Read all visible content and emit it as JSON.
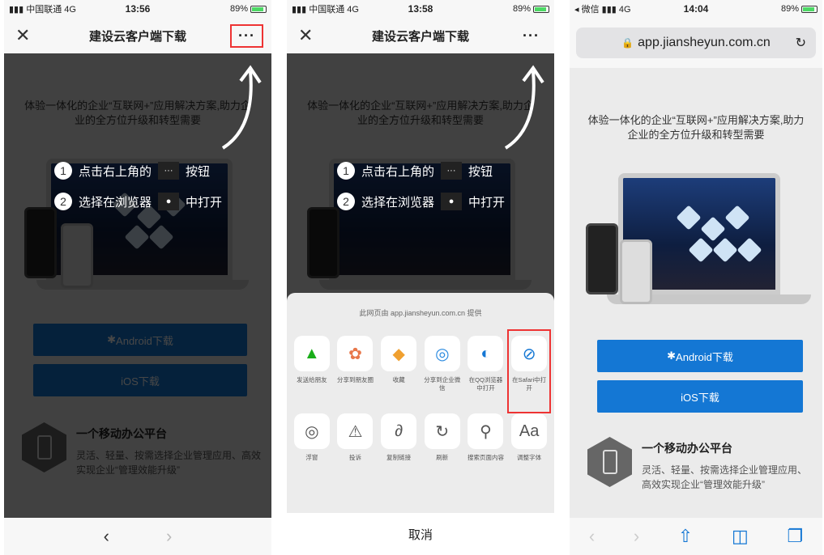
{
  "p1": {
    "status": {
      "carrier": "中国联通",
      "net": "4G",
      "time": "13:56",
      "battery": "89%"
    },
    "nav": {
      "close": "✕",
      "title": "建设云客户端下载",
      "more": "···"
    },
    "guide": {
      "step1_num": "1",
      "step1_text": "点击右上角的",
      "step1_icon": "···",
      "step1_after": "按钮",
      "step2_num": "2",
      "step2_text": "选择在浏览器",
      "step2_icon": "●",
      "step2_after": "中打开"
    },
    "bar": {
      "back": "‹",
      "fwd": "›"
    }
  },
  "p2": {
    "status": {
      "carrier": "中国联通",
      "net": "4G",
      "time": "13:58",
      "battery": "89%"
    },
    "nav": {
      "close": "✕",
      "title": "建设云客户端下载",
      "more": "···"
    },
    "sheet": {
      "source": "此网页由 app.jiansheyun.com.cn 提供",
      "row1": [
        {
          "icon": "▲",
          "label": "发送给朋友"
        },
        {
          "icon": "✿",
          "label": "分享到朋友圈"
        },
        {
          "icon": "◆",
          "label": "收藏"
        },
        {
          "icon": "◎",
          "label": "分享到企业微信"
        },
        {
          "icon": "◐",
          "label": "在QQ浏览器中打开"
        },
        {
          "icon": "⊘",
          "label": "在Safari中打开"
        }
      ],
      "row2": [
        {
          "icon": "◎",
          "label": "浮窗"
        },
        {
          "icon": "⚠",
          "label": "投诉"
        },
        {
          "icon": "∂",
          "label": "复制链接"
        },
        {
          "icon": "↻",
          "label": "刷新"
        },
        {
          "icon": "⚲",
          "label": "搜索页面内容"
        },
        {
          "icon": "Aa",
          "label": "调整字体"
        }
      ],
      "cancel": "取消"
    }
  },
  "p3": {
    "status": {
      "carrier": "微信",
      "net": "4G",
      "time": "14:04",
      "battery": "89%"
    },
    "url": "app.jiansheyun.com.cn",
    "bar": {
      "back": "‹",
      "fwd": "›",
      "share": "⇧",
      "book": "◫",
      "tabs": "❐"
    }
  },
  "content": {
    "tagline": "体验一体化的企业“互联网+”应用解决方案,助力企业的全方位升级和转型需要",
    "android": " Android下载",
    "ios": " iOS下载",
    "android_icon": "✱",
    "ios_icon": "",
    "feat_title": "一个移动办公平台",
    "feat_desc": "灵活、轻量、按需选择企业管理应用、高效实现企业“管理效能升级”"
  },
  "colors": {
    "accent": "#1477d4",
    "highlight": "#e33333"
  }
}
